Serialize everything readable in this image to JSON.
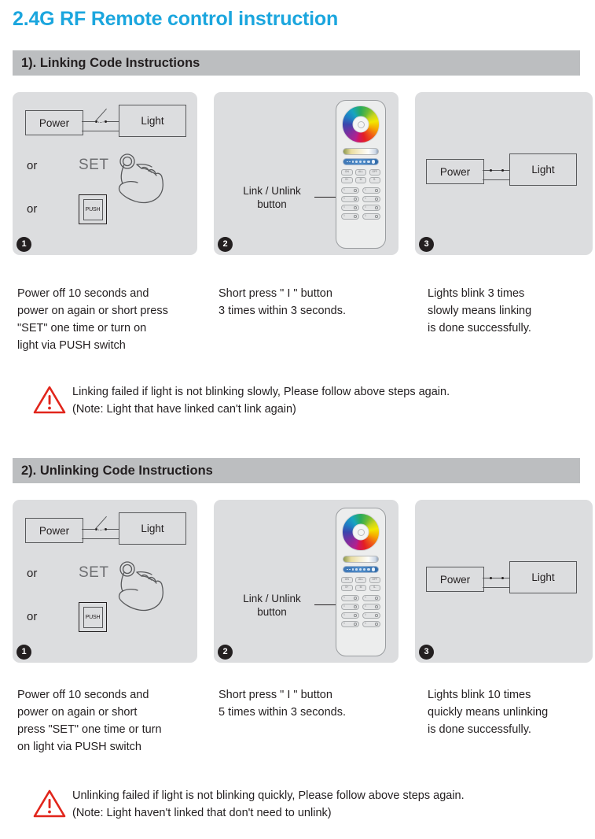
{
  "document": {
    "title": "2.4G RF Remote control instruction",
    "title_color": "#1ba6de",
    "header_bar_color": "#bcbec0",
    "panel_color": "#dcdddf",
    "warning_color": "#e1251b"
  },
  "sections": [
    {
      "header": "1). Linking Code Instructions",
      "panels": [
        {
          "badge": "1",
          "power_label": "Power",
          "light_label": "Light",
          "or_1": "or",
          "or_2": "or",
          "set_label": "SET",
          "push_label": "PUSH",
          "icons": [
            "power-light-switch-diagram",
            "hand-pointing-icon",
            "push-switch-icon"
          ]
        },
        {
          "badge": "2",
          "link_label": "Link / Unlink\nbutton",
          "remote": {
            "top_row_buttons": [
              "ON",
              "ALL",
              "OFF"
            ],
            "second_row_buttons": [
              "S+",
              "M",
              "S-"
            ],
            "zone_button_label": "I",
            "zone_rows": 4,
            "zone_columns": 2
          }
        },
        {
          "badge": "3",
          "power_label": "Power",
          "light_label": "Light",
          "icons": [
            "power-light-closed-circuit-diagram"
          ]
        }
      ],
      "captions": [
        "Power off 10 seconds and\npower on again or short press\n\"SET\" one time or turn on\nlight via PUSH switch",
        "Short press \" I \" button\n3 times within 3 seconds.",
        "Lights blink 3 times\nslowly means linking\nis done successfully."
      ],
      "warning": "Linking failed if light is not blinking slowly, Please follow above steps again.\n(Note: Light that have linked can't link again)"
    },
    {
      "header": "2). Unlinking Code Instructions",
      "panels": [
        {
          "badge": "1",
          "power_label": "Power",
          "light_label": "Light",
          "or_1": "or",
          "or_2": "or",
          "set_label": "SET",
          "push_label": "PUSH",
          "icons": [
            "power-light-switch-diagram",
            "hand-pointing-icon",
            "push-switch-icon"
          ]
        },
        {
          "badge": "2",
          "link_label": "Link / Unlink\nbutton",
          "remote": {
            "top_row_buttons": [
              "ON",
              "ALL",
              "OFF"
            ],
            "second_row_buttons": [
              "S+",
              "M",
              "S-"
            ],
            "zone_button_label": "I",
            "zone_rows": 4,
            "zone_columns": 2
          }
        },
        {
          "badge": "3",
          "power_label": "Power",
          "light_label": "Light",
          "icons": [
            "power-light-closed-circuit-diagram"
          ]
        }
      ],
      "captions": [
        "Power off 10 seconds and\npower on again or short\npress \"SET\" one time or turn\non light via PUSH switch",
        "Short press \" I \" button\n5 times within 3 seconds.",
        "Lights blink 10 times\nquickly means unlinking\nis done successfully."
      ],
      "warning": "Unlinking failed if light is not blinking quickly, Please follow above steps again.\n(Note: Light haven't linked that don't need to unlink)"
    }
  ]
}
